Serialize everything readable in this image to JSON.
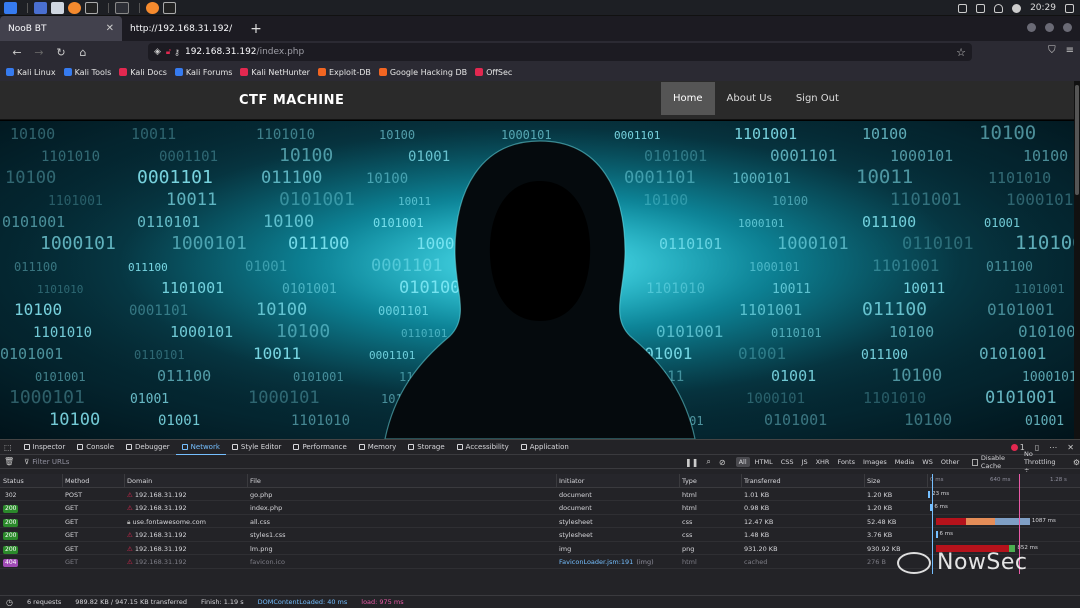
{
  "os": {
    "clock": "20:29"
  },
  "browser": {
    "tabs": [
      {
        "label": "NooB BT",
        "active": true
      },
      {
        "label": "http://192.168.31.192/",
        "active": false
      }
    ],
    "new_tab": "+",
    "url_host": "192.168.31.192",
    "url_path": "/index.php",
    "bookmarks": [
      {
        "label": "Kali Linux",
        "color": "#367bf0"
      },
      {
        "label": "Kali Tools",
        "color": "#367bf0"
      },
      {
        "label": "Kali Docs",
        "color": "#e22850"
      },
      {
        "label": "Kali Forums",
        "color": "#367bf0"
      },
      {
        "label": "Kali NetHunter",
        "color": "#e22850"
      },
      {
        "label": "Exploit-DB",
        "color": "#f26522"
      },
      {
        "label": "Google Hacking DB",
        "color": "#f26522"
      },
      {
        "label": "OffSec",
        "color": "#e22850"
      }
    ]
  },
  "site": {
    "title": "CTF MACHINE",
    "nav": [
      "Home",
      "About Us",
      "Sign Out"
    ]
  },
  "devtools": {
    "tabs": [
      "Inspector",
      "Console",
      "Debugger",
      "Network",
      "Style Editor",
      "Performance",
      "Memory",
      "Storage",
      "Accessibility",
      "Application"
    ],
    "active_tab": "Network",
    "error_count": "1",
    "filter_placeholder": "Filter URLs",
    "filter_types": [
      "All",
      "HTML",
      "CSS",
      "JS",
      "XHR",
      "Fonts",
      "Images",
      "Media",
      "WS",
      "Other"
    ],
    "disable_cache": "Disable Cache",
    "throttling": "No Throttling ÷",
    "columns": [
      "Status",
      "Method",
      "Domain",
      "File",
      "Initiator",
      "Type",
      "Transferred",
      "Size"
    ],
    "waterfall_ticks": [
      "0 ms",
      "640 ms",
      "1.28 s"
    ],
    "requests": [
      {
        "status": "302",
        "method": "POST",
        "domain": "192.168.31.192",
        "secure": false,
        "file": "go.php",
        "initiator": "document",
        "type": "html",
        "transferred": "1.01 KB",
        "size": "1.20 KB",
        "timing": "23 ms"
      },
      {
        "status": "200",
        "method": "GET",
        "domain": "192.168.31.192",
        "secure": false,
        "file": "index.php",
        "initiator": "document",
        "type": "html",
        "transferred": "0.98 KB",
        "size": "1.20 KB",
        "timing": "6 ms"
      },
      {
        "status": "200",
        "method": "GET",
        "domain": "use.fontawesome.com",
        "secure": true,
        "file": "all.css",
        "initiator": "stylesheet",
        "type": "css",
        "transferred": "12.47 KB",
        "size": "52.48 KB",
        "timing": "1087 ms"
      },
      {
        "status": "200",
        "method": "GET",
        "domain": "192.168.31.192",
        "secure": false,
        "file": "styles1.css",
        "initiator": "stylesheet",
        "type": "css",
        "transferred": "1.48 KB",
        "size": "3.76 KB",
        "timing": "6 ms"
      },
      {
        "status": "200",
        "method": "GET",
        "domain": "192.168.31.192",
        "secure": false,
        "file": "lm.png",
        "initiator": "img",
        "type": "png",
        "transferred": "931.20 KB",
        "size": "930.92 KB",
        "timing": "852 ms"
      },
      {
        "status": "404",
        "method": "GET",
        "domain": "192.168.31.192",
        "secure": false,
        "file": "favicon.ico",
        "initiator": "FaviconLoader.jsm:191",
        "initiator_suffix": "(img)",
        "type": "html",
        "transferred": "cached",
        "size": "276 B",
        "timing": ""
      }
    ],
    "summary": {
      "requests": "6 requests",
      "transferred": "989.82 KB / 947.15 KB transferred",
      "finish": "Finish: 1.19 s",
      "dom": "DOMContentLoaded: 40 ms",
      "load": "load: 975 ms"
    }
  },
  "watermark": "NowSec",
  "colors": {
    "status_200": "#2b8a2b",
    "status_302": "#2b2a33",
    "status_404": "#a04bb5",
    "accent_blue": "#75bfff",
    "accent_pink": "#e95ba7"
  }
}
